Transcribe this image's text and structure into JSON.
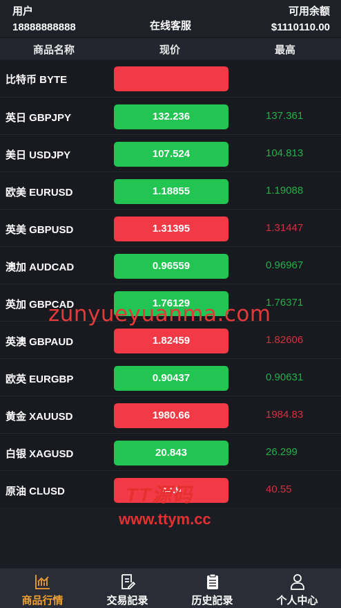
{
  "header": {
    "user_label": "用户",
    "user_value": "18888888888",
    "service_label": "在线客服",
    "balance_label": "可用余额",
    "balance_value": "$1110110.00"
  },
  "columns": {
    "name": "商品名称",
    "price": "现价",
    "high": "最高"
  },
  "rows": [
    {
      "name": "比特币 BYTE",
      "price": "",
      "high": "",
      "trend": "down"
    },
    {
      "name": "英日 GBPJPY",
      "price": "132.236",
      "high": "137.361",
      "trend": "up"
    },
    {
      "name": "美日 USDJPY",
      "price": "107.524",
      "high": "104.813",
      "trend": "up"
    },
    {
      "name": "欧美 EURUSD",
      "price": "1.18855",
      "high": "1.19088",
      "trend": "up"
    },
    {
      "name": "英美 GBPUSD",
      "price": "1.31395",
      "high": "1.31447",
      "trend": "down"
    },
    {
      "name": "澳加 AUDCAD",
      "price": "0.96559",
      "high": "0.96967",
      "trend": "up"
    },
    {
      "name": "英加 GBPCAD",
      "price": "1.76129",
      "high": "1.76371",
      "trend": "up"
    },
    {
      "name": "英澳 GBPAUD",
      "price": "1.82459",
      "high": "1.82606",
      "trend": "down"
    },
    {
      "name": "欧英 EURGBP",
      "price": "0.90437",
      "high": "0.90631",
      "trend": "up"
    },
    {
      "name": "黄金 XAUUSD",
      "price": "1980.66",
      "high": "1984.83",
      "trend": "down"
    },
    {
      "name": "白银 XAGUSD",
      "price": "20.843",
      "high": "26.299",
      "trend": "up"
    },
    {
      "name": "原油 CLUSD",
      "price": "44.9",
      "high": "40.55",
      "trend": "down"
    }
  ],
  "watermarks": {
    "main": "zunyueyuanma.com",
    "logo_text": "TT源码",
    "url": "www.ttym.cc"
  },
  "tabs": [
    {
      "label": "商品行情",
      "icon": "chart-icon",
      "active": true
    },
    {
      "label": "交易記录",
      "icon": "document-edit-icon",
      "active": false
    },
    {
      "label": "历史記录",
      "icon": "clipboard-icon",
      "active": false
    },
    {
      "label": "个人中心",
      "icon": "user-icon",
      "active": false
    }
  ],
  "colors": {
    "up": "#22c452",
    "down": "#f23a46",
    "accent": "#f0a030",
    "background": "#1b1d24"
  }
}
